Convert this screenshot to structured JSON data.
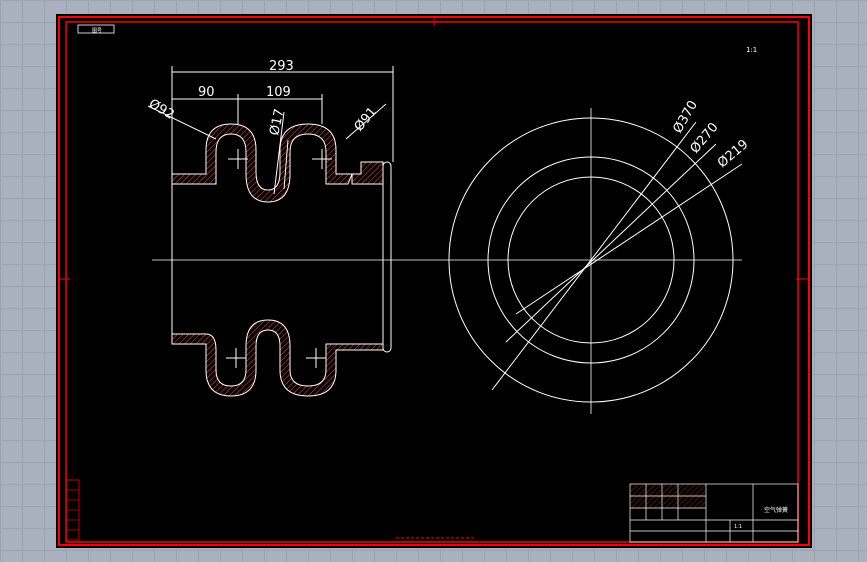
{
  "drawing": {
    "tag_label": "图号",
    "scale_note": "1:1",
    "dimensions": {
      "overall_width": "293",
      "left_span": "90",
      "right_span": "109",
      "dia_left": "Ø92",
      "dia_small": "Ø17",
      "dia_right": "Ø91",
      "dia_outer": "Ø370",
      "dia_mid": "Ø270",
      "dia_inner": "Ø219"
    },
    "title_block": {
      "part_name": "空气弹簧",
      "scale": "1:1"
    }
  },
  "colors": {
    "background": "#000000",
    "frame": "#ff0000",
    "lines": "#ffffff",
    "hatch": "#ff4040"
  }
}
